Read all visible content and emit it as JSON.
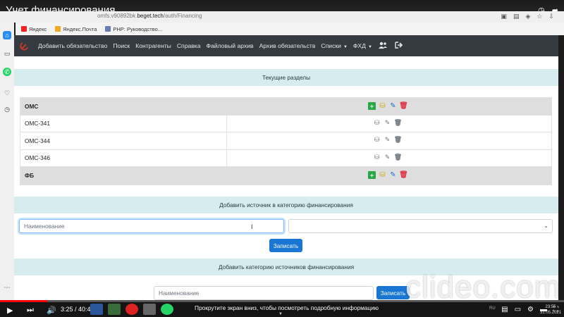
{
  "video": {
    "title": "Учет финансирования",
    "timecode": "3:25 / 40:40",
    "caption": "Прокрутите экран вниз, чтобы посмотреть подробную информацию",
    "progress": 0.084,
    "watermark": "clideo.com",
    "keyboard_lang": "RU",
    "tray_time": "23:55",
    "tray_date": "31.05.2021"
  },
  "browser": {
    "url_prefix": "omfs.v90892bk.",
    "url_domain": "beget.tech",
    "url_path": "/auth/Financing",
    "bookmarks": [
      "Яндекс",
      "Яндекс.Почта",
      "PHP: Руководство..."
    ]
  },
  "nav": {
    "items": [
      "Добавить обязательство",
      "Поиск",
      "Контрагенты",
      "Справка",
      "Файловый архив",
      "Архив обязательств",
      "Списки",
      "ФХД"
    ],
    "dropdown_items": [
      "Списки",
      "ФХД"
    ]
  },
  "sections": {
    "current": "Текущие разделы",
    "add_source": "Добавить источник в категорию финансирования",
    "add_category": "Добавить категорию источников финансирования"
  },
  "table": {
    "categories": [
      {
        "name": "ОМС",
        "items": [
          "ОМС-341",
          "ОМС-344",
          "ОМС-346"
        ]
      },
      {
        "name": "ФБ",
        "items": []
      }
    ]
  },
  "form_source": {
    "name_placeholder": "Наименование",
    "name_value": "",
    "select_value": "",
    "submit_label": "Записать"
  },
  "form_category": {
    "name_placeholder": "Наименование",
    "name_value": "",
    "submit_label": "Записать"
  },
  "colors": {
    "navbar": "#343a40",
    "section_header": "#d7ecee",
    "primary_button": "#1976d2",
    "add_icon": "#28a745",
    "delete_icon": "#dc3545",
    "coins_icon": "#c9a400",
    "edit_icon": "#1b6fd1"
  },
  "icons": [
    "hammer-sickle-logo",
    "users-icon",
    "logout-icon",
    "plus-square-icon",
    "coins-icon",
    "edit-icon",
    "trash-icon"
  ]
}
